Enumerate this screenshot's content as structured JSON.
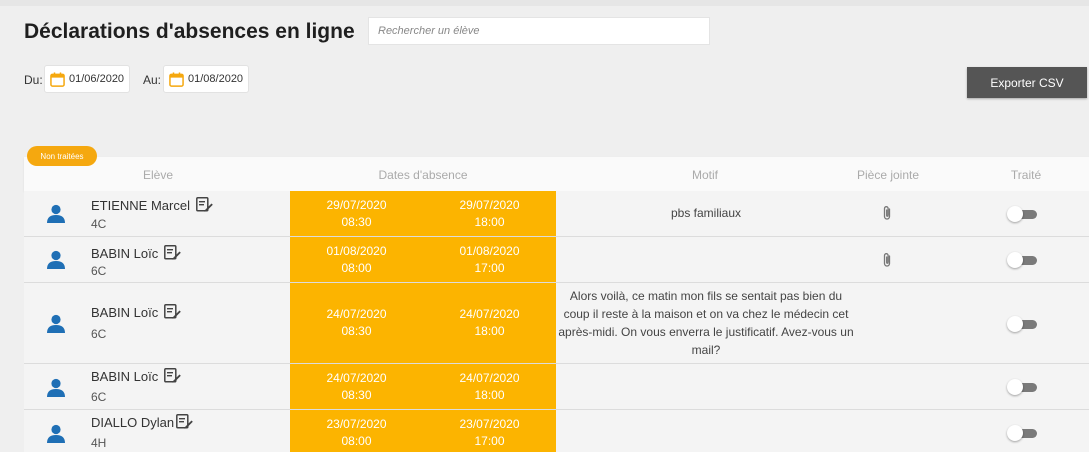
{
  "page": {
    "title": "Déclarations d'absences en ligne"
  },
  "search": {
    "placeholder": "Rechercher un élève",
    "value": ""
  },
  "filters": {
    "from_label": "Du:",
    "from_date": "01/06/2020",
    "to_label": "Au:",
    "to_date": "01/08/2020",
    "status_badge": "Non traitées"
  },
  "toolbar": {
    "export_label": "Exporter CSV"
  },
  "table": {
    "columns": [
      "Elève",
      "Dates d'absence",
      "Motif",
      "Pièce jointe",
      "Traité"
    ],
    "rows": [
      {
        "name": "ETIENNE Marcel",
        "class": "4C",
        "start_date": "29/07/2020",
        "start_time": "08:30",
        "end_date": "29/07/2020",
        "end_time": "18:00",
        "motif": "pbs familiaux",
        "attachment": true,
        "treated": false
      },
      {
        "name": "BABIN Loïc",
        "class": "6C",
        "start_date": "01/08/2020",
        "start_time": "08:00",
        "end_date": "01/08/2020",
        "end_time": "17:00",
        "motif": "",
        "attachment": true,
        "treated": false
      },
      {
        "name": "BABIN Loïc",
        "class": "6C",
        "start_date": "24/07/2020",
        "start_time": "08:30",
        "end_date": "24/07/2020",
        "end_time": "18:00",
        "motif": "Alors voilà, ce matin mon fils se sentait pas bien du coup il reste à la maison et on va chez le médecin cet après-midi. On vous enverra le justificatif. Avez-vous un mail?",
        "attachment": false,
        "treated": false
      },
      {
        "name": "BABIN Loïc",
        "class": "6C",
        "start_date": "24/07/2020",
        "start_time": "08:30",
        "end_date": "24/07/2020",
        "end_time": "18:00",
        "motif": "",
        "attachment": false,
        "treated": false
      },
      {
        "name": "DIALLO Dylan",
        "class": "4H",
        "start_date": "23/07/2020",
        "start_time": "08:00",
        "end_date": "23/07/2020",
        "end_time": "17:00",
        "motif": "",
        "attachment": false,
        "treated": false
      }
    ]
  },
  "colors": {
    "accent": "#fcb400",
    "badge": "#f5a80f",
    "avatar": "#1f6fb5",
    "export_button": "#555555"
  }
}
